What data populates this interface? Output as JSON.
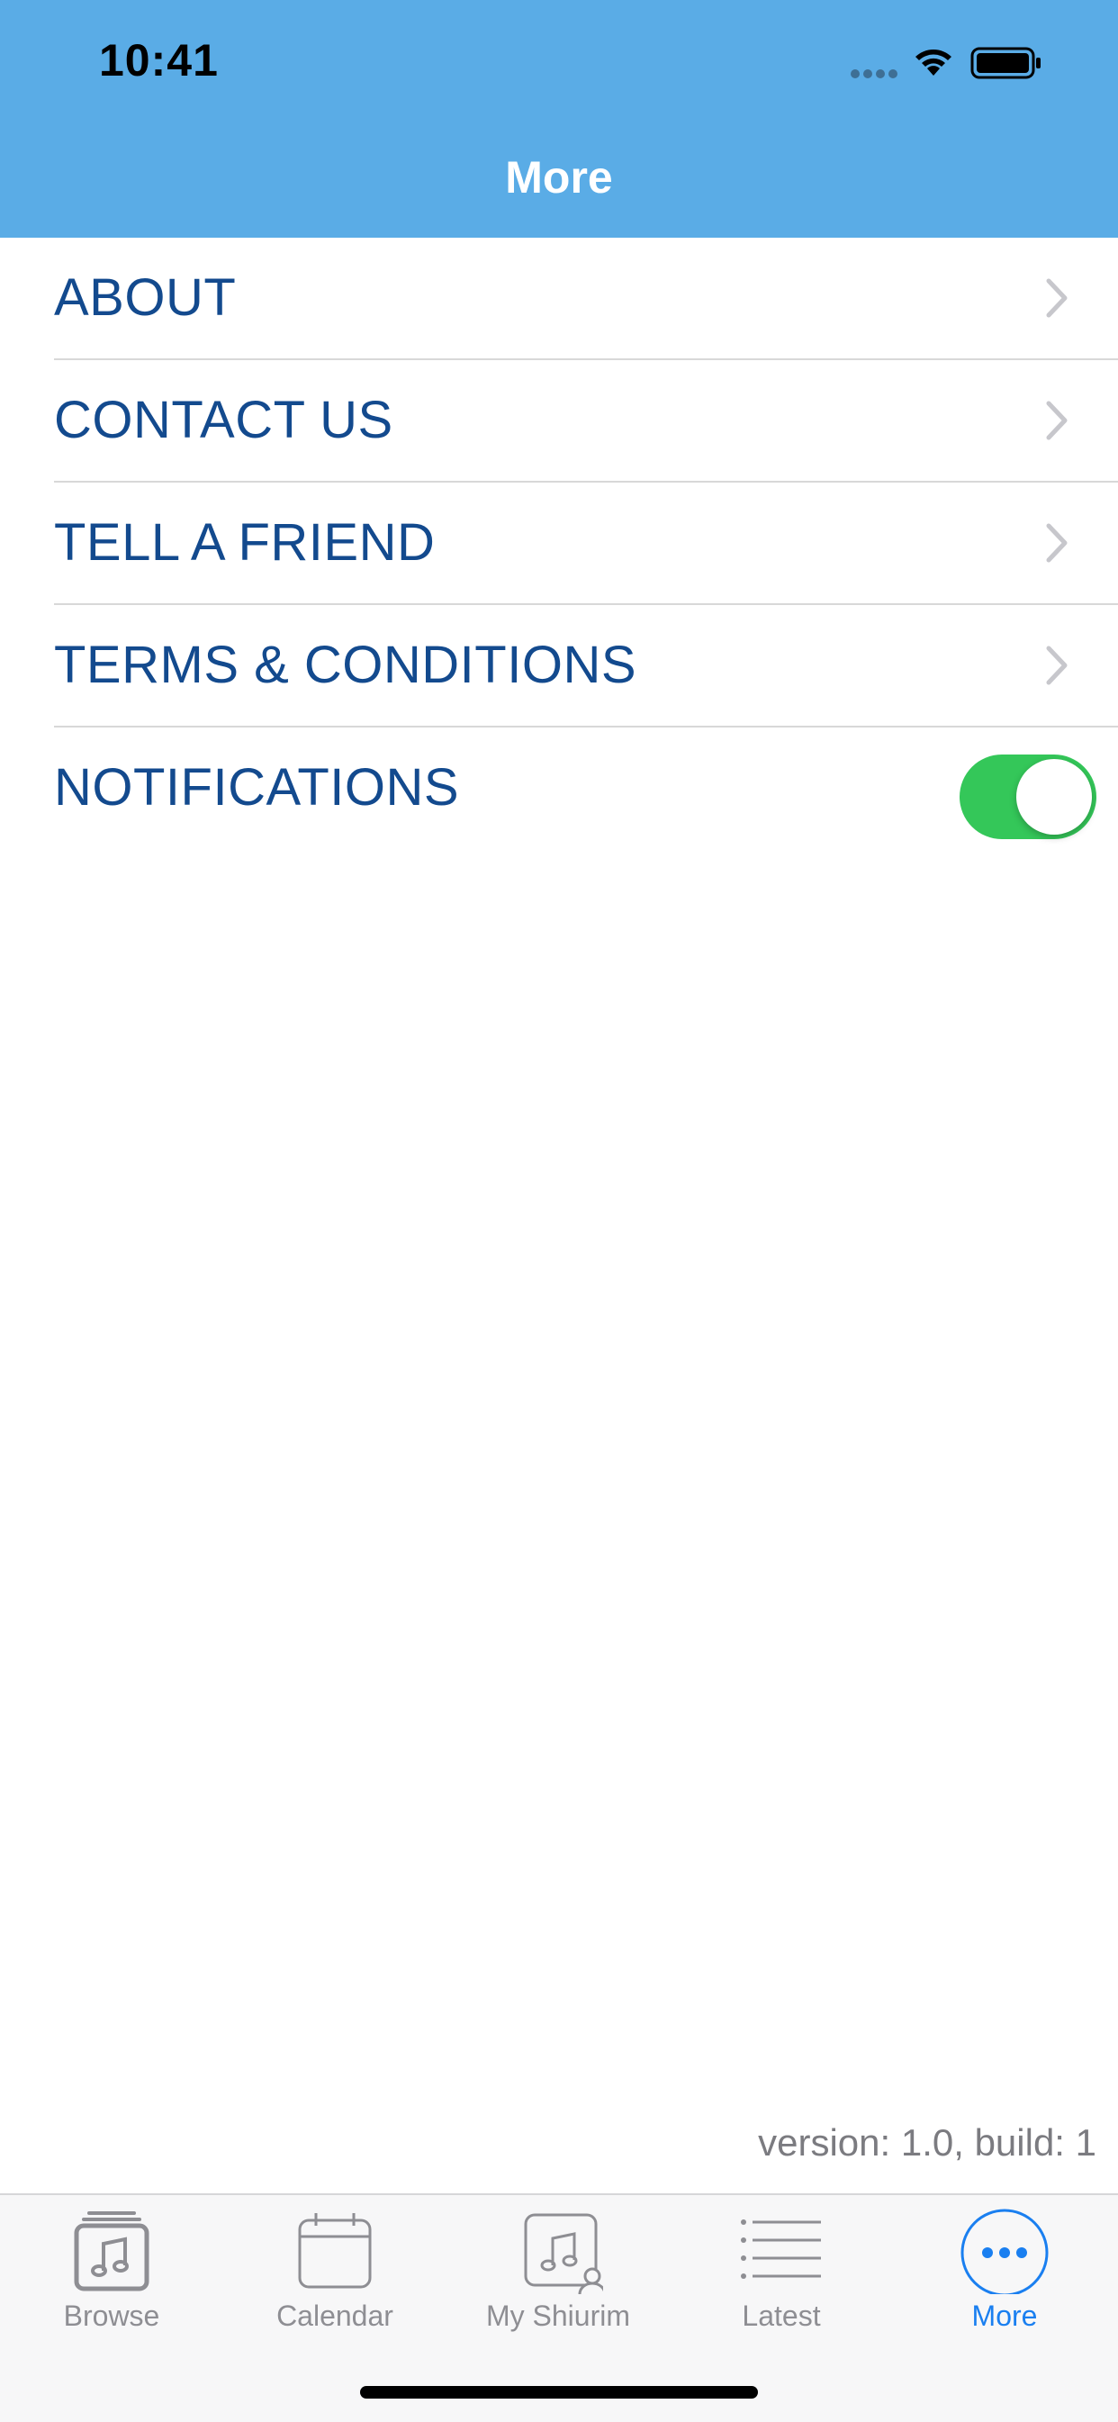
{
  "status_bar": {
    "time": "10:41"
  },
  "nav": {
    "title": "More"
  },
  "menu": {
    "items": [
      {
        "label": "ABOUT"
      },
      {
        "label": "CONTACT US"
      },
      {
        "label": "TELL A FRIEND"
      },
      {
        "label": "TERMS & CONDITIONS"
      }
    ],
    "notifications": {
      "label": "NOTIFICATIONS",
      "enabled": true
    }
  },
  "footer": {
    "version": "version: 1.0, build: 1"
  },
  "tabbar": {
    "tabs": [
      {
        "label": "Browse",
        "icon": "music-folder-icon"
      },
      {
        "label": "Calendar",
        "icon": "calendar-icon"
      },
      {
        "label": "My Shiurim",
        "icon": "my-music-icon"
      },
      {
        "label": "Latest",
        "icon": "list-icon"
      },
      {
        "label": "More",
        "icon": "more-icon",
        "active": true
      }
    ]
  },
  "colors": {
    "header": "#5aace6",
    "menu_text": "#134a8e",
    "toggle_on": "#34c759",
    "tab_active": "#1a7ff0",
    "tab_inactive": "#8e8e93"
  }
}
